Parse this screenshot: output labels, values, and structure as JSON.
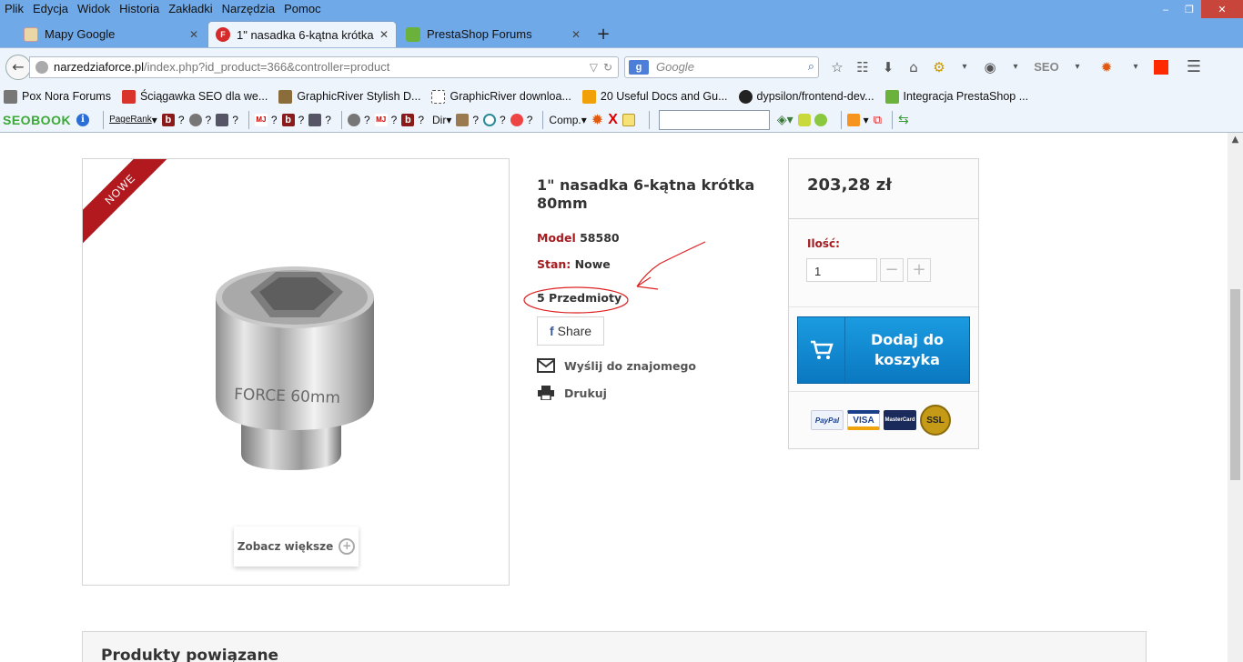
{
  "menubar": {
    "items": [
      "Plik",
      "Edycja",
      "Widok",
      "Historia",
      "Zakładki",
      "Narzędzia",
      "Pomoc"
    ]
  },
  "tabs": [
    {
      "label": "Mapy Google",
      "icon": "google-maps-icon"
    },
    {
      "label": "1\" nasadka 6-kątna krótka ...",
      "icon": "narzedziaforce-icon"
    },
    {
      "label": "PrestaShop Forums",
      "icon": "prestashop-icon"
    }
  ],
  "nav": {
    "url_host": "narzedziaforce.pl",
    "url_path": "/index.php?id_product=366&controller=product",
    "search_placeholder": "Google"
  },
  "bookmarks": [
    {
      "label": "Pox Nora Forums",
      "color": "#777777"
    },
    {
      "label": "Ściągawka SEO dla we...",
      "color": "#d9342b"
    },
    {
      "label": "GraphicRiver Stylish D...",
      "color": "#8a6d3b"
    },
    {
      "label": "GraphicRiver downloa...",
      "color": "#ffffff"
    },
    {
      "label": "20 Useful Docs and Gu...",
      "color": "#f2a007"
    },
    {
      "label": "dypsilon/frontend-dev...",
      "color": "#222222"
    },
    {
      "label": "Integracja PrestaShop ...",
      "color": "#6ab23b"
    }
  ],
  "addonbar": {
    "seobook": "SEOBOOK",
    "pagerank": "PageRank",
    "dir": "Dir",
    "comp": "Comp.",
    "q": "?"
  },
  "product": {
    "badge": "NOWE",
    "title": "1\" nasadka 6-kątna krótka 80mm",
    "model_label": "Model",
    "model_value": "58580",
    "condition_label": "Stan:",
    "condition_value": "Nowe",
    "quantity_text": "5 Przedmioty",
    "share_label": "Share",
    "send_friend": "Wyślij do znajomego",
    "print": "Drukuj",
    "zoom": "Zobacz większe",
    "engraving": "FORCE 60mm"
  },
  "buy": {
    "price": "203,28 zł",
    "qty_label": "Ilość:",
    "qty_value": "1",
    "add_to_cart_line1": "Dodaj do",
    "add_to_cart_line2": "koszyka",
    "minus": "−",
    "plus": "+"
  },
  "payment_logos": [
    "PayPal",
    "VISA",
    "MasterCard",
    "SSL"
  ],
  "related": {
    "title": "Produkty powiązane"
  },
  "colors": {
    "accent_red": "#a51a1e",
    "cart_blue": "#0a78c1",
    "chrome_blue": "#6fa9e8"
  }
}
